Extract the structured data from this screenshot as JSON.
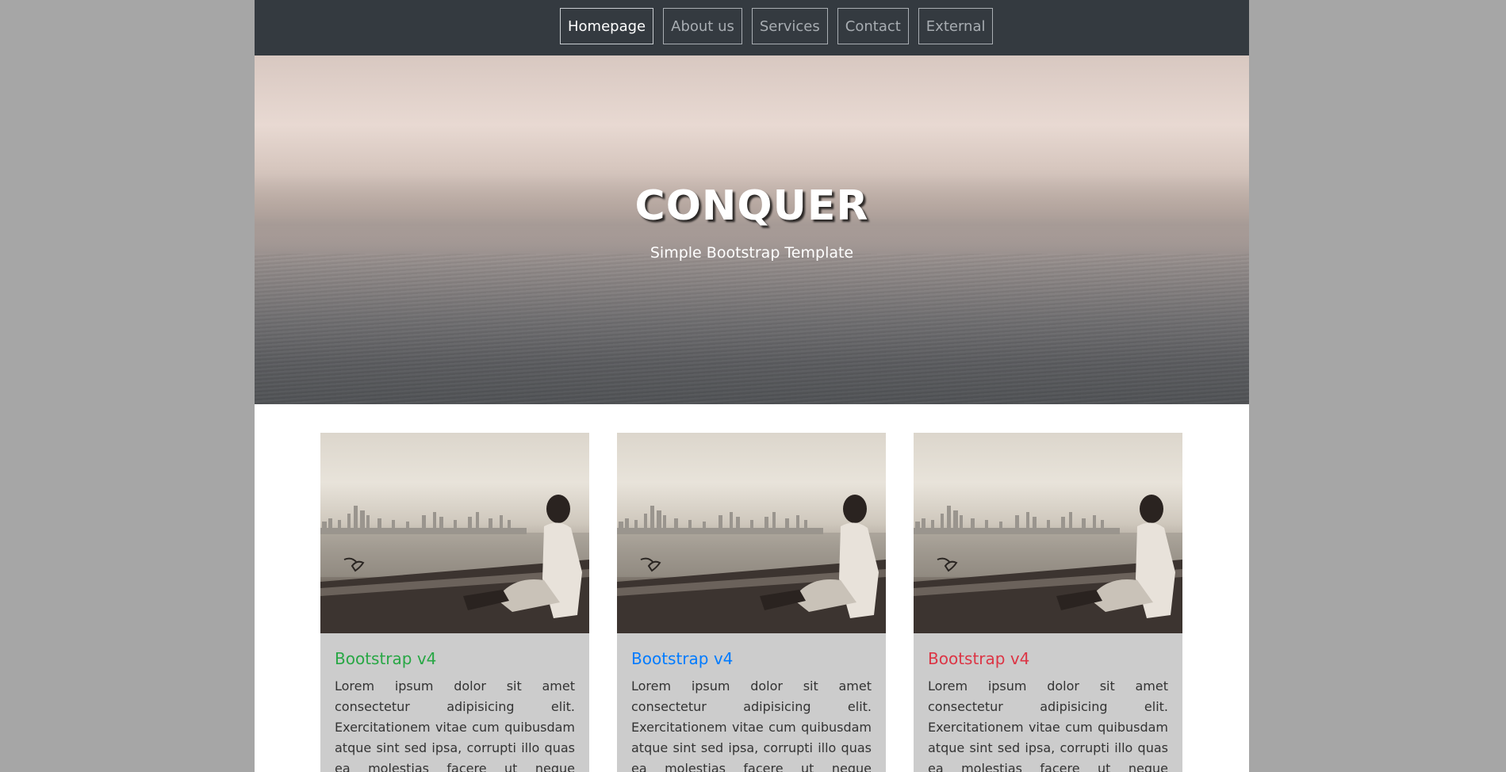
{
  "nav": {
    "items": [
      {
        "label": "Homepage",
        "active": true
      },
      {
        "label": "About us",
        "active": false
      },
      {
        "label": "Services",
        "active": false
      },
      {
        "label": "Contact",
        "active": false
      },
      {
        "label": "External",
        "active": false
      }
    ]
  },
  "hero": {
    "title": "CONQUER",
    "subtitle": "Simple Bootstrap Template"
  },
  "cards": [
    {
      "title": "Bootstrap v4",
      "title_color": "#28a745",
      "text": "Lorem ipsum dolor sit amet consectetur adipisicing elit. Exercitationem vitae cum quibusdam atque sint sed ipsa, corrupti illo quas ea molestias facere ut neque provident"
    },
    {
      "title": "Bootstrap v4",
      "title_color": "#007bff",
      "text": "Lorem ipsum dolor sit amet consectetur adipisicing elit. Exercitationem vitae cum quibusdam atque sint sed ipsa, corrupti illo quas ea molestias facere ut neque provident"
    },
    {
      "title": "Bootstrap v4",
      "title_color": "#dc3545",
      "text": "Lorem ipsum dolor sit amet consectetur adipisicing elit. Exercitationem vitae cum quibusdam atque sint sed ipsa, corrupti illo quas ea molestias facere ut neque provident"
    }
  ],
  "colors": {
    "page_bg": "#a6a6a6",
    "navbar_bg": "#343a40",
    "card_bg": "#cccccc"
  }
}
